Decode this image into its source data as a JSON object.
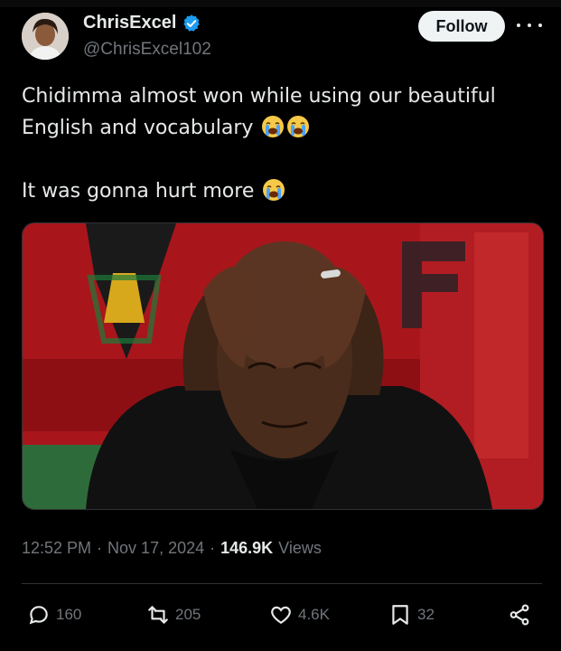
{
  "tweet": {
    "author_name": "ChrisExcel",
    "handle": "@ChrisExcel102",
    "follow_label": "Follow",
    "line1": "Chidimma almost won while using our beautiful",
    "line2": "English and vocabulary",
    "line3": "It was gonna hurt more",
    "time": "12:52 PM",
    "sep1": "·",
    "date": "Nov 17, 2024",
    "sep2": "·",
    "views_count": "146.9K",
    "views_label": "Views"
  },
  "actions": {
    "replies": "160",
    "reposts": "205",
    "likes": "4.6K",
    "bookmarks": "32"
  },
  "icons": [
    "verified-badge-icon",
    "more-icon",
    "crying-face-emoji",
    "reply-icon",
    "repost-icon",
    "like-icon",
    "bookmark-icon",
    "share-icon"
  ],
  "colors": {
    "background": "#000000",
    "text": "#e7e9ea",
    "muted": "#71767b",
    "verified": "#1d9bf0"
  }
}
